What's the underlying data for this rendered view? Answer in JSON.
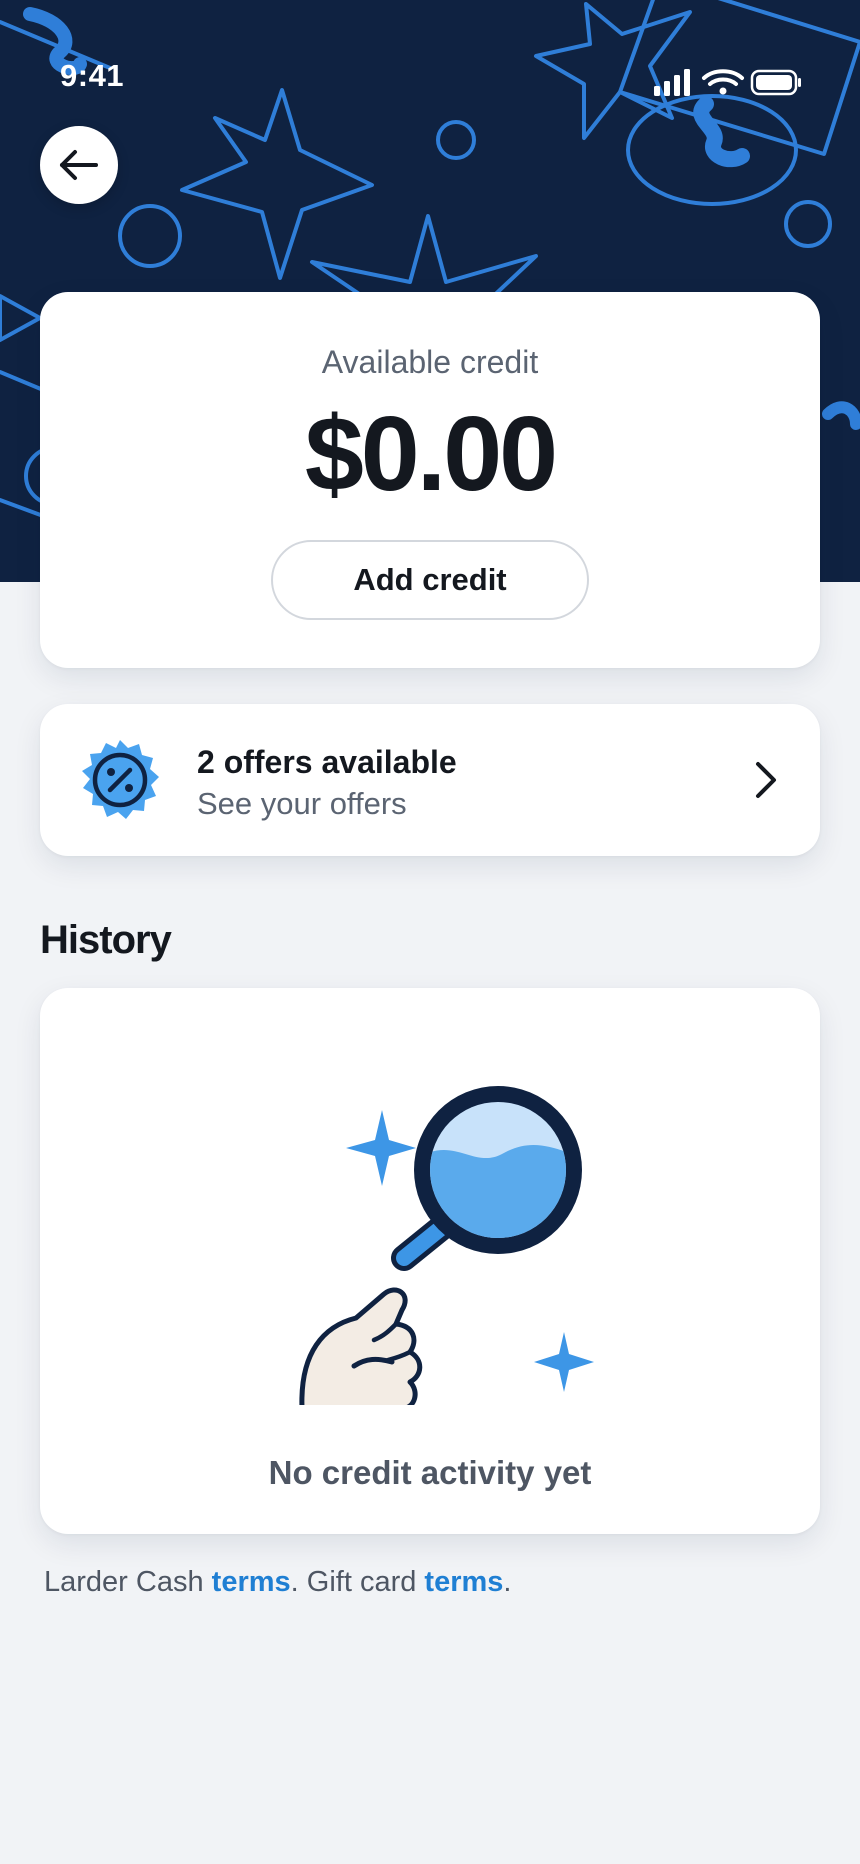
{
  "status_bar": {
    "time": "9:41",
    "icons": [
      "cellular-signal-icon",
      "wifi-icon",
      "battery-icon"
    ]
  },
  "header": {
    "back_icon": "arrow-left-icon",
    "background_color": "#0f2241",
    "pattern_color": "#2f7ed8"
  },
  "credit": {
    "label": "Available credit",
    "amount": "$0.00",
    "add_button_label": "Add credit"
  },
  "offers": {
    "icon": "percent-badge-icon",
    "title": "2 offers available",
    "subtitle": "See your offers",
    "chevron_icon": "chevron-right-icon"
  },
  "history": {
    "heading": "History",
    "empty_icon": "magnifying-glass-hand-icon",
    "empty_text": "No credit activity yet"
  },
  "footer": {
    "text_1": "Larder Cash ",
    "link_1": "terms",
    "text_2": ". Gift card ",
    "link_2": "terms",
    "text_3": "."
  },
  "colors": {
    "accent": "#1f7fd3",
    "accent_light": "#4aa3ef",
    "navy": "#0f2241",
    "page_background": "#f1f3f6"
  }
}
